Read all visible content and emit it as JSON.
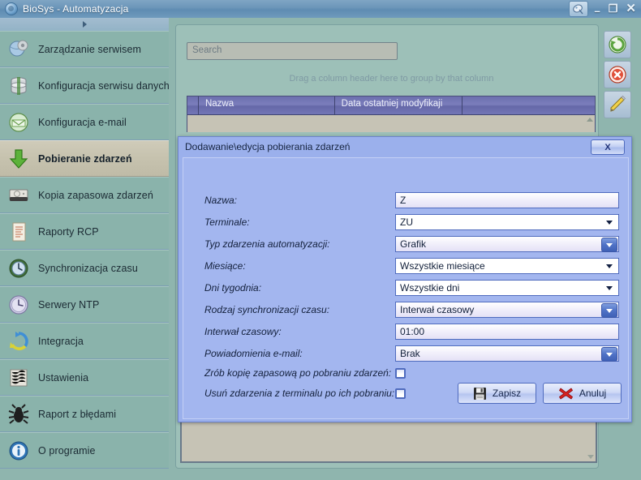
{
  "window": {
    "title": "BioSys - Automatyzacja",
    "app_icon": "satellite-dish-icon",
    "plugin_icon": "satellite-dish-icon",
    "minimize_label": "–",
    "maximize_label": "❐",
    "close_label": "✕"
  },
  "sidebar": {
    "scroll_up_icon": "scroll-arrow-icon",
    "items": [
      {
        "label": "Zarządzanie serwisem",
        "icon": "service-gear-globe-icon",
        "selected": false
      },
      {
        "label": "Konfiguracja serwisu danych",
        "icon": "database-icon",
        "selected": false
      },
      {
        "label": "Konfiguracja e-mail",
        "icon": "email-circle-icon",
        "selected": false
      },
      {
        "label": "Pobieranie zdarzeń",
        "icon": "green-down-arrow-icon",
        "selected": true
      },
      {
        "label": "Kopia zapasowa zdarzeń",
        "icon": "hard-drive-icon",
        "selected": false
      },
      {
        "label": "Raporty RCP",
        "icon": "document-report-icon",
        "selected": false
      },
      {
        "label": "Synchronizacja czasu",
        "icon": "clock-sync-icon",
        "selected": false
      },
      {
        "label": "Serwery NTP",
        "icon": "clock-icon",
        "selected": false
      },
      {
        "label": "Integracja",
        "icon": "integration-refresh-icon",
        "selected": false
      },
      {
        "label": "Ustawienia",
        "icon": "settings-icon",
        "selected": false
      },
      {
        "label": "Raport z błędami",
        "icon": "bug-icon",
        "selected": false
      },
      {
        "label": "O programie",
        "icon": "info-icon",
        "selected": false
      }
    ]
  },
  "main": {
    "search": {
      "placeholder": "Search",
      "value": ""
    },
    "group_hint": "Drag a column header here to group by that column",
    "grid": {
      "columns": [
        "Nazwa",
        "Data ostatniej modyfikaji",
        ""
      ],
      "rows": []
    },
    "tools": [
      {
        "name": "add-refresh-button",
        "icon": "green-refresh-icon"
      },
      {
        "name": "delete-button",
        "icon": "red-delete-icon"
      },
      {
        "name": "edit-button",
        "icon": "yellow-pencil-icon"
      }
    ]
  },
  "dialog": {
    "title": "Dodawanie\\edycja pobierania zdarzeń",
    "close_label": "X",
    "fields": [
      {
        "label": "Nazwa:",
        "value": "Z",
        "type": "text"
      },
      {
        "label": "Terminale:",
        "value": "ZU",
        "type": "combo"
      },
      {
        "label": "Typ zdarzenia automatyzacji:",
        "value": "Grafik",
        "type": "lookup"
      },
      {
        "label": "Miesiące:",
        "value": "Wszystkie miesiące",
        "type": "combo"
      },
      {
        "label": "Dni tygodnia:",
        "value": "Wszystkie dni",
        "type": "combo"
      },
      {
        "label": "Rodzaj synchronizacji czasu:",
        "value": "Interwał czasowy",
        "type": "lookup"
      },
      {
        "label": "Interwał czasowy:",
        "value": "01:00",
        "type": "text"
      },
      {
        "label": "Powiadomienia e-mail:",
        "value": "Brak",
        "type": "lookup"
      }
    ],
    "checkboxes": [
      {
        "label": "Zrób kopię zapasową po pobraniu zdarzeń:",
        "checked": false
      },
      {
        "label": "Usuń zdarzenia z terminalu po ich pobraniu:",
        "checked": false
      }
    ],
    "buttons": [
      {
        "label": "Zapisz",
        "icon": "floppy-save-icon"
      },
      {
        "label": "Anuluj",
        "icon": "red-x-cancel-icon"
      }
    ]
  },
  "colors": {
    "titlebar": "#6e97ba",
    "sidebar": "#8fb5ae",
    "sidebar_selected": "#c6c2ae",
    "dialog": "#a3b6ef",
    "dialog_border": "#4f6bbe",
    "grid_header": "#6c6fae",
    "panel": "#9dc0b8"
  }
}
